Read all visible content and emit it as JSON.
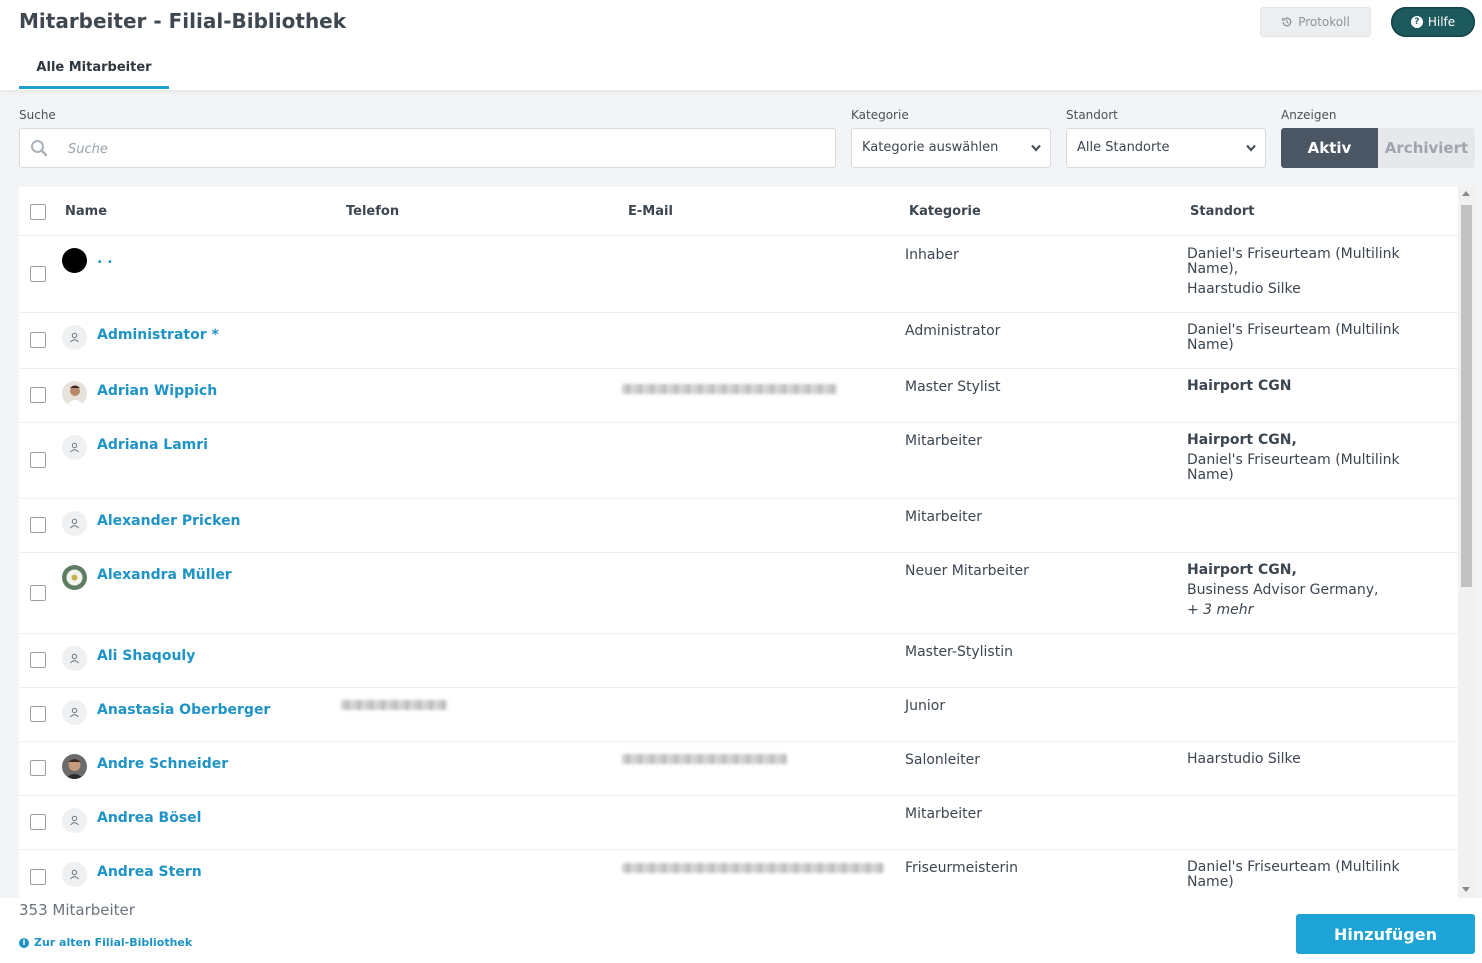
{
  "header": {
    "title": "Mitarbeiter - Filial-Bibliothek",
    "protokoll_label": "Protokoll",
    "hilfe_label": "Hilfe",
    "tab_label": "Alle Mitarbeiter"
  },
  "filters": {
    "search_label": "Suche",
    "search_placeholder": "Suche",
    "kategorie_label": "Kategorie",
    "kategorie_value": "Kategorie auswählen",
    "standort_label": "Standort",
    "standort_value": "Alle Standorte",
    "anzeigen_label": "Anzeigen",
    "aktiv_label": "Aktiv",
    "archiviert_label": "Archiviert"
  },
  "table": {
    "columns": {
      "name": "Name",
      "telefon": "Telefon",
      "email": "E-Mail",
      "kategorie": "Kategorie",
      "standort": "Standort"
    },
    "rows": [
      {
        "name": ". .",
        "kategorie": "Inhaber",
        "standort": [
          "Daniel's Friseurteam (Multilink Name),",
          "Haarstudio Silke"
        ]
      },
      {
        "name": "Administrator *",
        "kategorie": "Administrator",
        "standort": [
          "Daniel's Friseurteam (Multilink Name)"
        ]
      },
      {
        "name": "Adrian Wippich",
        "kategorie": "Master Stylist",
        "standort": [
          "Hairport CGN"
        ]
      },
      {
        "name": "Adriana Lamri",
        "kategorie": "Mitarbeiter",
        "standort": [
          "Hairport CGN,",
          "Daniel's Friseurteam (Multilink Name)"
        ]
      },
      {
        "name": "Alexander Pricken",
        "kategorie": "Mitarbeiter",
        "standort": []
      },
      {
        "name": "Alexandra Müller",
        "kategorie": "Neuer Mitarbeiter",
        "standort": [
          "Hairport CGN,",
          "Business Advisor Germany,",
          "+ 3 mehr"
        ]
      },
      {
        "name": "Ali Shaqouly",
        "kategorie": "Master-Stylistin",
        "standort": []
      },
      {
        "name": "Anastasia Oberberger",
        "kategorie": "Junior",
        "standort": []
      },
      {
        "name": "Andre Schneider",
        "kategorie": "Salonleiter",
        "standort": [
          "Haarstudio Silke"
        ]
      },
      {
        "name": "Andrea Bösel",
        "kategorie": "Mitarbeiter",
        "standort": []
      },
      {
        "name": "Andrea Stern",
        "kategorie": "Friseurmeisterin",
        "standort": [
          "Daniel's Friseurteam (Multilink Name)"
        ]
      }
    ]
  },
  "footer": {
    "count": "353 Mitarbeiter",
    "old_link": "Zur alten Filial-Bibliothek",
    "add_label": "Hinzufügen"
  },
  "colors": {
    "accent": "#1ea3d6",
    "link": "#1e93c6",
    "help": "#1d5a5e",
    "segment_active": "#4a5664"
  }
}
